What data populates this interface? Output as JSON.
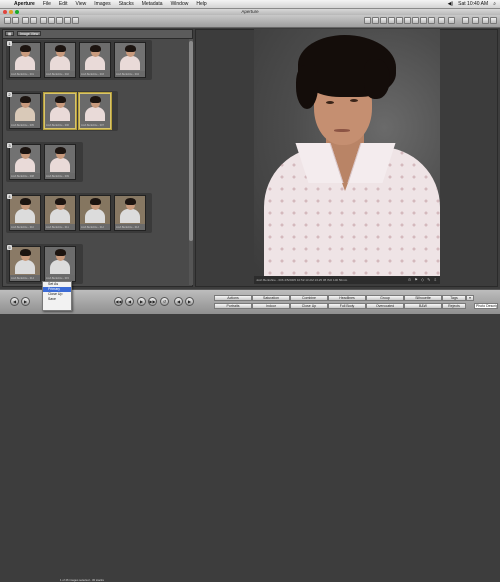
{
  "menubar": {
    "app": "Aperture",
    "items": [
      "File",
      "Edit",
      "View",
      "Images",
      "Stacks",
      "Metadata",
      "Window",
      "Help"
    ],
    "clock": "Sat 10:40 AM"
  },
  "window": {
    "title": "Aperture"
  },
  "browser": {
    "tab_label": "Image View",
    "stacks": [
      {
        "number": "1",
        "thumbs": [
          {
            "caption": "Josh Berkshire - 001"
          },
          {
            "caption": "Josh Berkshire - 002"
          },
          {
            "caption": "Josh Berkshire - 003"
          },
          {
            "caption": "Josh Berkshire - 004"
          }
        ]
      },
      {
        "number": "2",
        "thumbs": [
          {
            "caption": "Josh Berkshire - 005"
          },
          {
            "caption": "Josh Berkshire - 006"
          },
          {
            "caption": "Josh Berkshire - 007"
          }
        ]
      },
      {
        "number": "3",
        "thumbs": [
          {
            "caption": "Josh Berkshire - 008"
          },
          {
            "caption": "Josh Berkshire - 009"
          }
        ]
      },
      {
        "number": "4",
        "thumbs": [
          {
            "caption": "Josh Berkshire - 010"
          },
          {
            "caption": "Josh Berkshire - 011"
          },
          {
            "caption": "Josh Berkshire - 012"
          },
          {
            "caption": "Josh Berkshire - 013"
          }
        ]
      },
      {
        "number": "5",
        "thumbs": [
          {
            "caption": "Josh Berkshire - 014"
          },
          {
            "caption": "Josh Berkshire - 015"
          }
        ]
      }
    ],
    "status": "1 of 26 images selected - 30 stacks"
  },
  "viewer": {
    "metadata_line": "Josh Berkshire - 006  4/5/2005 10:52:13 AM  1/125  f/8  ISO 100  50mm"
  },
  "popup_menu": {
    "items": [
      "Set As",
      "Primary",
      "Close Up",
      "Save"
    ],
    "highlighted": 1
  },
  "bottombar": {
    "nav": [
      "◀",
      "▶"
    ],
    "playback": [
      "◀◀",
      "◀",
      "▶",
      "▶▶"
    ],
    "arrows": [
      "◀",
      "▶"
    ],
    "buttons": [
      {
        "label": "Actions"
      },
      {
        "label": "Saturation"
      },
      {
        "label": "Combine"
      },
      {
        "label": "Headlines"
      },
      {
        "label": "Group"
      },
      {
        "label": "Silhouette"
      },
      {
        "label": "Tags"
      },
      {
        "label": "Portraits"
      },
      {
        "label": "Indoor"
      },
      {
        "label": "Close Up"
      },
      {
        "label": "Full Body"
      },
      {
        "label": "Overcoated"
      },
      {
        "label": "B&W"
      },
      {
        "label": "Rejects"
      }
    ],
    "search_placeholder": "Photo Description"
  }
}
